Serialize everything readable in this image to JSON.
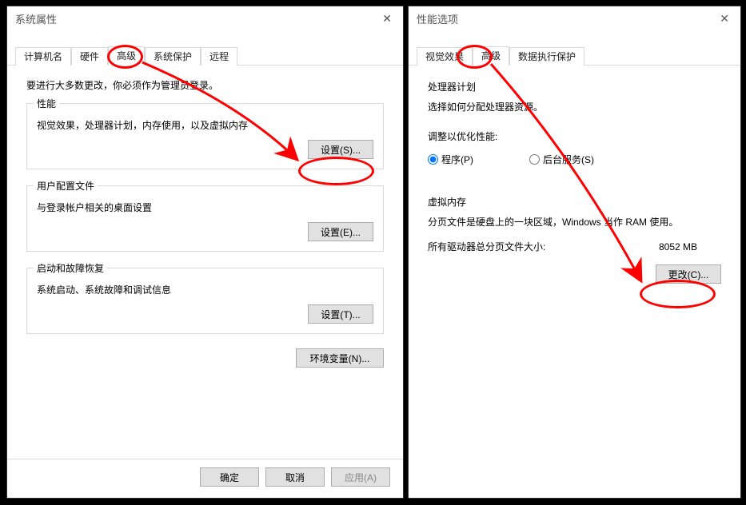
{
  "left_dialog": {
    "title": "系统属性",
    "tabs": [
      "计算机名",
      "硬件",
      "高级",
      "系统保护",
      "远程"
    ],
    "active_tab_index": 2,
    "note": "要进行大多数更改，你必须作为管理员登录。",
    "groups": [
      {
        "title": "性能",
        "desc": "视觉效果，处理器计划，内存使用，以及虚拟内存",
        "button": "设置(S)..."
      },
      {
        "title": "用户配置文件",
        "desc": "与登录帐户相关的桌面设置",
        "button": "设置(E)..."
      },
      {
        "title": "启动和故障恢复",
        "desc": "系统启动、系统故障和调试信息",
        "button": "设置(T)..."
      }
    ],
    "env_button": "环境变量(N)...",
    "ok": "确定",
    "cancel": "取消",
    "apply": "应用(A)"
  },
  "right_dialog": {
    "title": "性能选项",
    "tabs": [
      "视觉效果",
      "高级",
      "数据执行保护"
    ],
    "active_tab_index": 1,
    "processor": {
      "title": "处理器计划",
      "desc": "选择如何分配处理器资源。",
      "optimize_label": "调整以优化性能:",
      "opt_programs": "程序(P)",
      "opt_services": "后台服务(S)"
    },
    "vm": {
      "title": "虚拟内存",
      "desc": "分页文件是硬盘上的一块区域，Windows 当作 RAM 使用。",
      "total_label": "所有驱动器总分页文件大小:",
      "total_value": "8052 MB",
      "change_button": "更改(C)..."
    }
  }
}
